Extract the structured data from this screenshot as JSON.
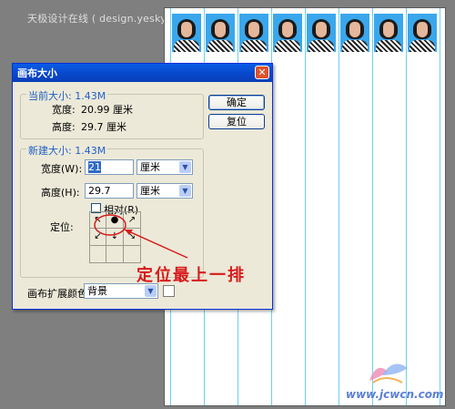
{
  "watermark": "天极设计在线 ( design.yesky.com ) 图文教程",
  "dialog": {
    "title": "画布大小",
    "close_glyph": "✕",
    "current_size": {
      "legend": "当前大小: 1.43M",
      "width_label": "宽度:",
      "width_value": "20.99 厘米",
      "height_label": "高度:",
      "height_value": "29.7 厘米"
    },
    "new_size": {
      "legend": "新建大小: 1.43M",
      "width_label": "宽度(W):",
      "width_value": "21",
      "width_unit": "厘米",
      "height_label": "高度(H):",
      "height_value": "29.7",
      "height_unit": "厘米",
      "relative_label": "相对(R)",
      "anchor_label": "定位:",
      "anchor_cells": [
        "↖",
        "●",
        "↗",
        "↙",
        "↓",
        "↘",
        "",
        "",
        ""
      ]
    },
    "buttons": {
      "ok": "确定",
      "reset": "复位"
    },
    "ext_color_label": "画布扩展颜色:",
    "ext_color_value": "背景"
  },
  "annotation": "定位最上一排",
  "site": "www.jcwcn.com",
  "colors": {
    "annotation": "#d81b1b",
    "guide": "#6fcff0",
    "photo_bg": "#3aa7ec",
    "titlebar": "#0846c9"
  }
}
